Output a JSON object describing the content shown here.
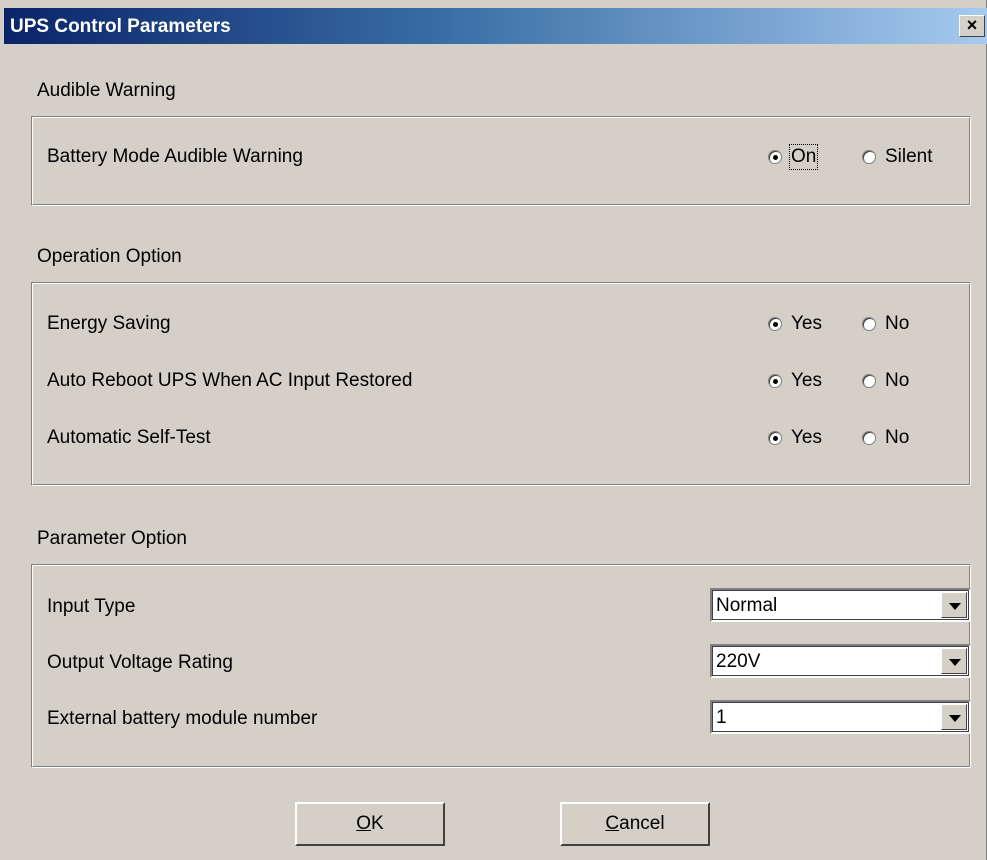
{
  "window": {
    "title": "UPS Control Parameters",
    "close_glyph": "×"
  },
  "audible_warning": {
    "heading": "Audible Warning",
    "rows": [
      {
        "label": "Battery Mode Audible Warning",
        "options": [
          "On",
          "Silent"
        ],
        "selected": "On"
      }
    ]
  },
  "operation_option": {
    "heading": "Operation Option",
    "rows": [
      {
        "label": "Energy Saving",
        "options": [
          "Yes",
          "No"
        ],
        "selected": "Yes"
      },
      {
        "label": "Auto Reboot UPS When AC Input Restored",
        "options": [
          "Yes",
          "No"
        ],
        "selected": "Yes"
      },
      {
        "label": "Automatic Self-Test",
        "options": [
          "Yes",
          "No"
        ],
        "selected": "Yes"
      }
    ]
  },
  "parameter_option": {
    "heading": "Parameter Option",
    "rows": [
      {
        "label": "Input Type",
        "value": "Normal"
      },
      {
        "label": "Output Voltage Rating",
        "value": "220V"
      },
      {
        "label": "External battery module number",
        "value": "1"
      }
    ]
  },
  "buttons": {
    "ok_mnemonic": "O",
    "ok_rest": "K",
    "cancel_mnemonic": "C",
    "cancel_rest": "ancel"
  },
  "colors": {
    "dialog_bg": "#d4d0c8",
    "titlebar_start": "#0a246a",
    "titlebar_end": "#a6caf0"
  },
  "icons": [
    "close-icon",
    "chevron-down-icon"
  ]
}
